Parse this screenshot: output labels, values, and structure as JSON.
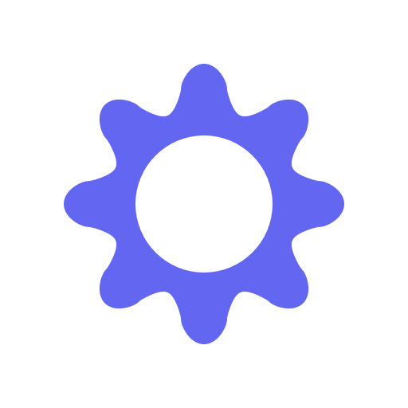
{
  "icon": {
    "name": "gear-icon",
    "teeth": 8,
    "color": "#6366F1",
    "background": "#FFFFFF"
  }
}
